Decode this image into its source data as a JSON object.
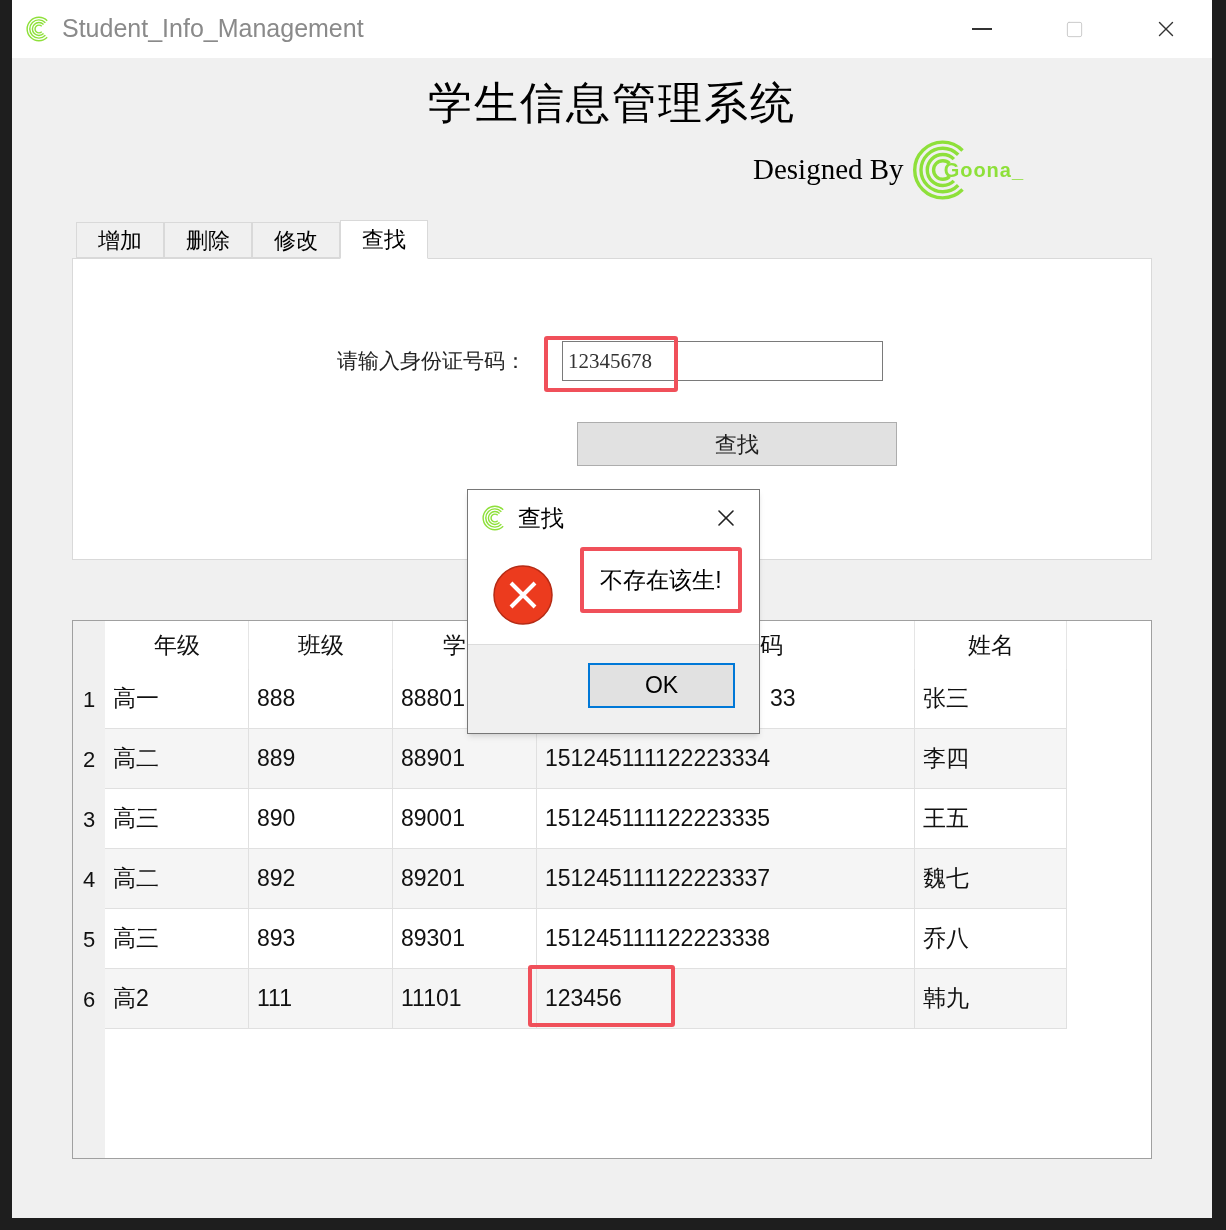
{
  "window": {
    "title": "Student_Info_Management"
  },
  "heading": "学生信息管理系统",
  "credit": {
    "text": "Designed By",
    "logo_text": "Goona_"
  },
  "tabs": [
    {
      "label": "增加",
      "selected": false
    },
    {
      "label": "删除",
      "selected": false
    },
    {
      "label": "修改",
      "selected": false
    },
    {
      "label": "查找",
      "selected": true
    }
  ],
  "search": {
    "label": "请输入身份证号码：",
    "value": "12345678",
    "highlighted": true,
    "button": "查找"
  },
  "table": {
    "columns": [
      "年级",
      "班级",
      "学",
      "码",
      "姓名"
    ],
    "rows": [
      {
        "number": "1",
        "cells": [
          {
            "text": "高一",
            "highlighted": false
          },
          {
            "text": "888",
            "highlighted": false
          },
          {
            "text": "88801",
            "highlighted": false
          },
          {
            "text": "33",
            "highlighted": false
          },
          {
            "text": "张三",
            "highlighted": false
          }
        ]
      },
      {
        "number": "2",
        "cells": [
          {
            "text": "高二",
            "highlighted": false
          },
          {
            "text": "889",
            "highlighted": false
          },
          {
            "text": "88901",
            "highlighted": false
          },
          {
            "text": "151245111122223334",
            "highlighted": false
          },
          {
            "text": "李四",
            "highlighted": false
          }
        ]
      },
      {
        "number": "3",
        "cells": [
          {
            "text": "高三",
            "highlighted": false
          },
          {
            "text": "890",
            "highlighted": false
          },
          {
            "text": "89001",
            "highlighted": false
          },
          {
            "text": "151245111122223335",
            "highlighted": false
          },
          {
            "text": "王五",
            "highlighted": false
          }
        ]
      },
      {
        "number": "4",
        "cells": [
          {
            "text": "高二",
            "highlighted": false
          },
          {
            "text": "892",
            "highlighted": false
          },
          {
            "text": "89201",
            "highlighted": false
          },
          {
            "text": "151245111122223337",
            "highlighted": false
          },
          {
            "text": "魏七",
            "highlighted": false
          }
        ]
      },
      {
        "number": "5",
        "cells": [
          {
            "text": "高三",
            "highlighted": false
          },
          {
            "text": "893",
            "highlighted": false
          },
          {
            "text": "89301",
            "highlighted": false
          },
          {
            "text": "151245111122223338",
            "highlighted": false
          },
          {
            "text": "乔八",
            "highlighted": false
          }
        ]
      },
      {
        "number": "6",
        "cells": [
          {
            "text": "高2",
            "highlighted": false
          },
          {
            "text": "111",
            "highlighted": false
          },
          {
            "text": "11101",
            "highlighted": false
          },
          {
            "text": "123456",
            "highlighted": true
          },
          {
            "text": "韩九",
            "highlighted": false
          }
        ]
      }
    ]
  },
  "dialog": {
    "title": "查找",
    "message": "不存在该生!",
    "message_highlighted": true,
    "button": "OK"
  }
}
